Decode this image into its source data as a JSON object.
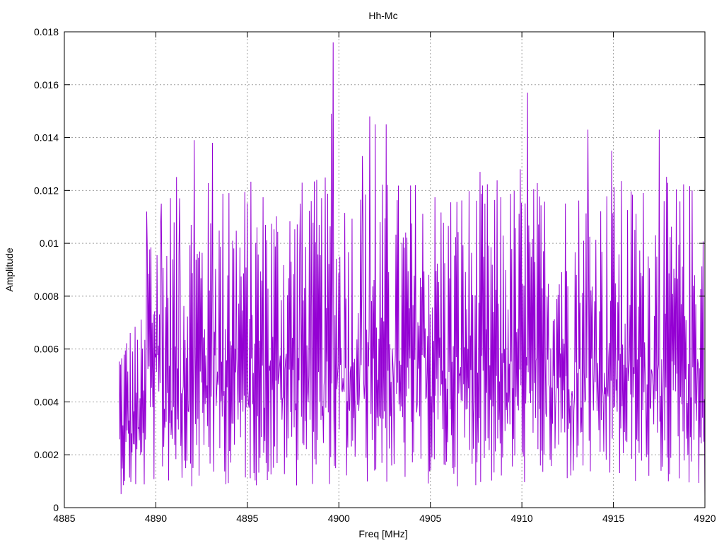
{
  "chart_data": {
    "type": "line",
    "title": "Hh-Mc",
    "xlabel": "Freq [MHz]",
    "ylabel": "Amplitude",
    "xlim": [
      4885,
      4920
    ],
    "ylim": [
      0,
      0.018
    ],
    "xticks": [
      "4885",
      "4890",
      "4895",
      "4900",
      "4905",
      "4910",
      "4915",
      "4920"
    ],
    "yticks": [
      "0",
      "0.002",
      "0.004",
      "0.006",
      "0.008",
      "0.01",
      "0.012",
      "0.014",
      "0.016",
      "0.018"
    ],
    "grid": true,
    "legend": "none",
    "series": [
      {
        "color": "#9400d3",
        "x_start": 4888,
        "x_end": 4920,
        "x_step": 0.0333,
        "description_note": "dense noisy spectrum; peaks listed below, remainder estimated",
        "peaks": [
          {
            "x": 4889.5,
            "y": 0.0112
          },
          {
            "x": 4890.3,
            "y": 0.0115
          },
          {
            "x": 4891.3,
            "y": 0.0117
          },
          {
            "x": 4892.1,
            "y": 0.0139
          },
          {
            "x": 4893.1,
            "y": 0.0138
          },
          {
            "x": 4894.0,
            "y": 0.0119
          },
          {
            "x": 4896.0,
            "y": 0.0107
          },
          {
            "x": 4897.9,
            "y": 0.0115
          },
          {
            "x": 4898.5,
            "y": 0.0116
          },
          {
            "x": 4899.7,
            "y": 0.0176
          },
          {
            "x": 4899.6,
            "y": 0.0149
          },
          {
            "x": 4901.3,
            "y": 0.0133
          },
          {
            "x": 4901.7,
            "y": 0.0148
          },
          {
            "x": 4902.0,
            "y": 0.0145
          },
          {
            "x": 4902.6,
            "y": 0.0145
          },
          {
            "x": 4904.2,
            "y": 0.0122
          },
          {
            "x": 4907.7,
            "y": 0.0127
          },
          {
            "x": 4909.9,
            "y": 0.0128
          },
          {
            "x": 4910.3,
            "y": 0.0157
          },
          {
            "x": 4913.6,
            "y": 0.0143
          },
          {
            "x": 4914.9,
            "y": 0.0135
          },
          {
            "x": 4917.5,
            "y": 0.0143
          }
        ]
      }
    ]
  }
}
